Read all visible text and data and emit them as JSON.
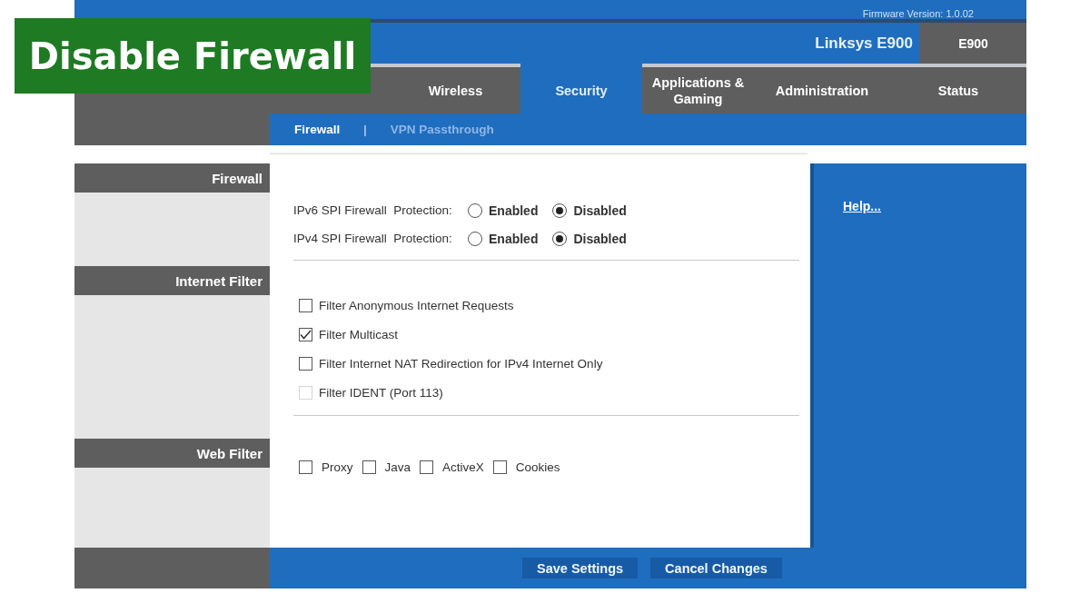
{
  "banner": {
    "title": "Disable Firewall"
  },
  "header": {
    "firmware": "Firmware Version: 1.0.02",
    "product_name": "Linksys E900",
    "model": "E900"
  },
  "tabs": [
    {
      "label": "Wireless",
      "selected": false
    },
    {
      "label": "Security",
      "selected": true
    },
    {
      "label": "Applications &\nGaming",
      "selected": false
    },
    {
      "label": "Administration",
      "selected": false
    },
    {
      "label": "Status",
      "selected": false
    }
  ],
  "subtabs": [
    {
      "label": "Firewall",
      "selected": true
    },
    {
      "label": "VPN Passthrough",
      "selected": false
    }
  ],
  "subtab_separator": "|",
  "sections": [
    {
      "title": "Firewall"
    },
    {
      "title": "Internet Filter"
    },
    {
      "title": "Web Filter"
    }
  ],
  "firewall": [
    {
      "label": "IPv6 SPI Firewall  Protection:",
      "options": [
        {
          "label": "Enabled",
          "selected": false
        },
        {
          "label": "Disabled",
          "selected": true
        }
      ]
    },
    {
      "label": "IPv4 SPI Firewall  Protection:",
      "options": [
        {
          "label": "Enabled",
          "selected": false
        },
        {
          "label": "Disabled",
          "selected": true
        }
      ]
    }
  ],
  "internet_filter": [
    {
      "label": "Filter Anonymous Internet Requests",
      "checked": false,
      "disabled": false
    },
    {
      "label": "Filter Multicast",
      "checked": true,
      "disabled": false
    },
    {
      "label": "Filter Internet NAT Redirection for IPv4 Internet Only",
      "checked": false,
      "disabled": false
    },
    {
      "label": "Filter IDENT (Port 113)",
      "checked": false,
      "disabled": true
    }
  ],
  "web_filter": [
    {
      "label": "Proxy",
      "checked": false
    },
    {
      "label": "Java",
      "checked": false
    },
    {
      "label": "ActiveX",
      "checked": false
    },
    {
      "label": "Cookies",
      "checked": false
    }
  ],
  "help_link": "Help...",
  "buttons": [
    "Save Settings",
    "Cancel Changes"
  ]
}
